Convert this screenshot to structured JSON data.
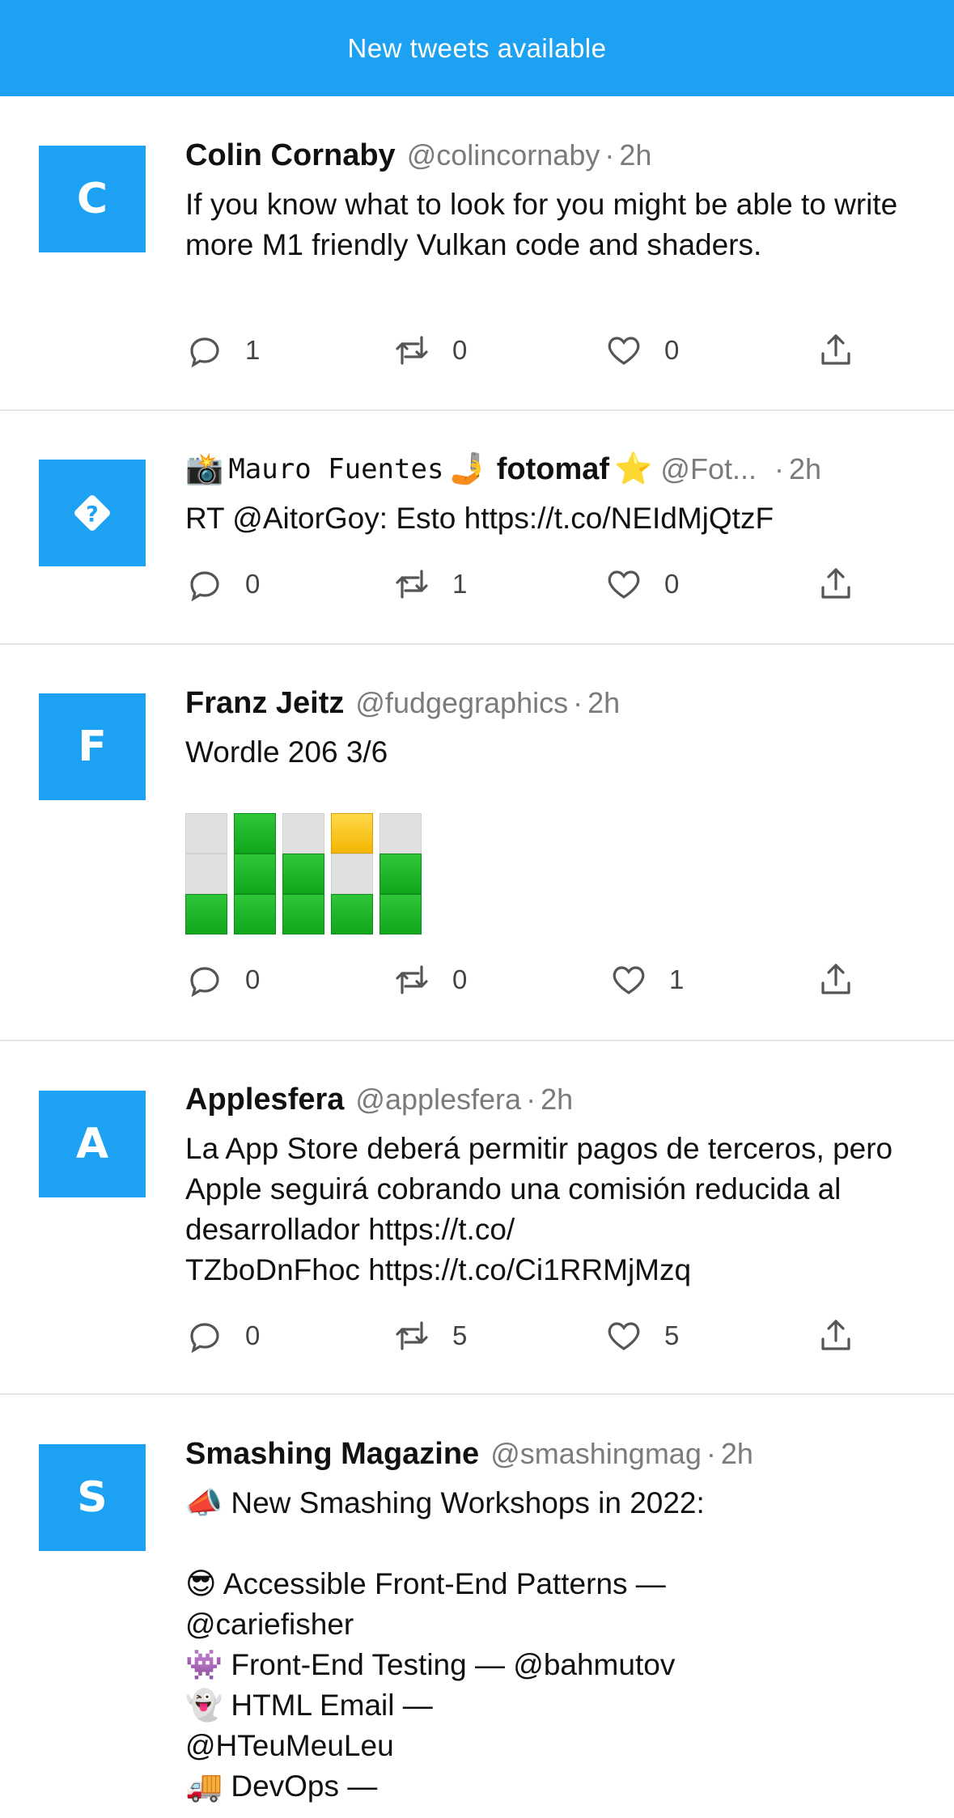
{
  "banner": {
    "label": "New tweets available"
  },
  "tweets": [
    {
      "avatar_letter": "C",
      "name": "Colin Cornaby",
      "handle": "@colincornaby",
      "separator": "·",
      "time": "2h",
      "text": "If you know what to look for you might be able to write more M1 friendly Vulkan code and shaders.",
      "replies": "1",
      "retweets": "0",
      "likes": "0"
    },
    {
      "avatar_icon": "question-icon",
      "name_prefix_emoji": "📸",
      "name_plain": "Mauro Fuentes",
      "name_emoji": "🤳",
      "name": "fotomaf",
      "name_suffix_emoji": "⭐",
      "handle": "@Fot...",
      "separator": "·",
      "time": "2h",
      "text": "RT @AitorGoy: Esto https://t.co/NEIdMjQtzF",
      "replies": "0",
      "retweets": "1",
      "likes": "0"
    },
    {
      "avatar_letter": "F",
      "name": "Franz Jeitz",
      "handle": "@fudgegraphics",
      "separator": "·",
      "time": "2h",
      "text": "Wordle 206 3/6",
      "wordle": [
        [
          "w",
          "g",
          "w",
          "y",
          "w"
        ],
        [
          "w",
          "g",
          "g",
          "w",
          "g"
        ],
        [
          "g",
          "g",
          "g",
          "g",
          "g"
        ]
      ],
      "replies": "0",
      "retweets": "0",
      "likes": "1"
    },
    {
      "avatar_letter": "A",
      "name": "Applesfera",
      "handle": "@applesfera",
      "separator": "·",
      "time": "2h",
      "text": "La App Store deberá permitir pagos de terceros, pero Apple seguirá cobrando una comisión reducida al desarrollador https://t.co/\nTZboDnFhoc https://t.co/Ci1RRMjMzq",
      "replies": "0",
      "retweets": "5",
      "likes": "5"
    },
    {
      "avatar_letter": "S",
      "name": "Smashing Magazine",
      "handle": "@smashingmag",
      "separator": "·",
      "time": "2h",
      "text": "📣 New Smashing Workshops in 2022:\n\n😎 Accessible Front-End Patterns —\n@cariefisher\n👾 Front-End Testing — @bahmutov\n👻 HTML Email —\n@HTeuMeuLeu\n🚚 DevOps —"
    }
  ],
  "colors": {
    "accent": "#1da1f2",
    "muted": "#7b7b7b",
    "divider": "#e6e6e6"
  },
  "icons": {
    "reply": "reply-icon",
    "retweet": "retweet-icon",
    "like": "heart-icon",
    "share": "share-icon"
  }
}
